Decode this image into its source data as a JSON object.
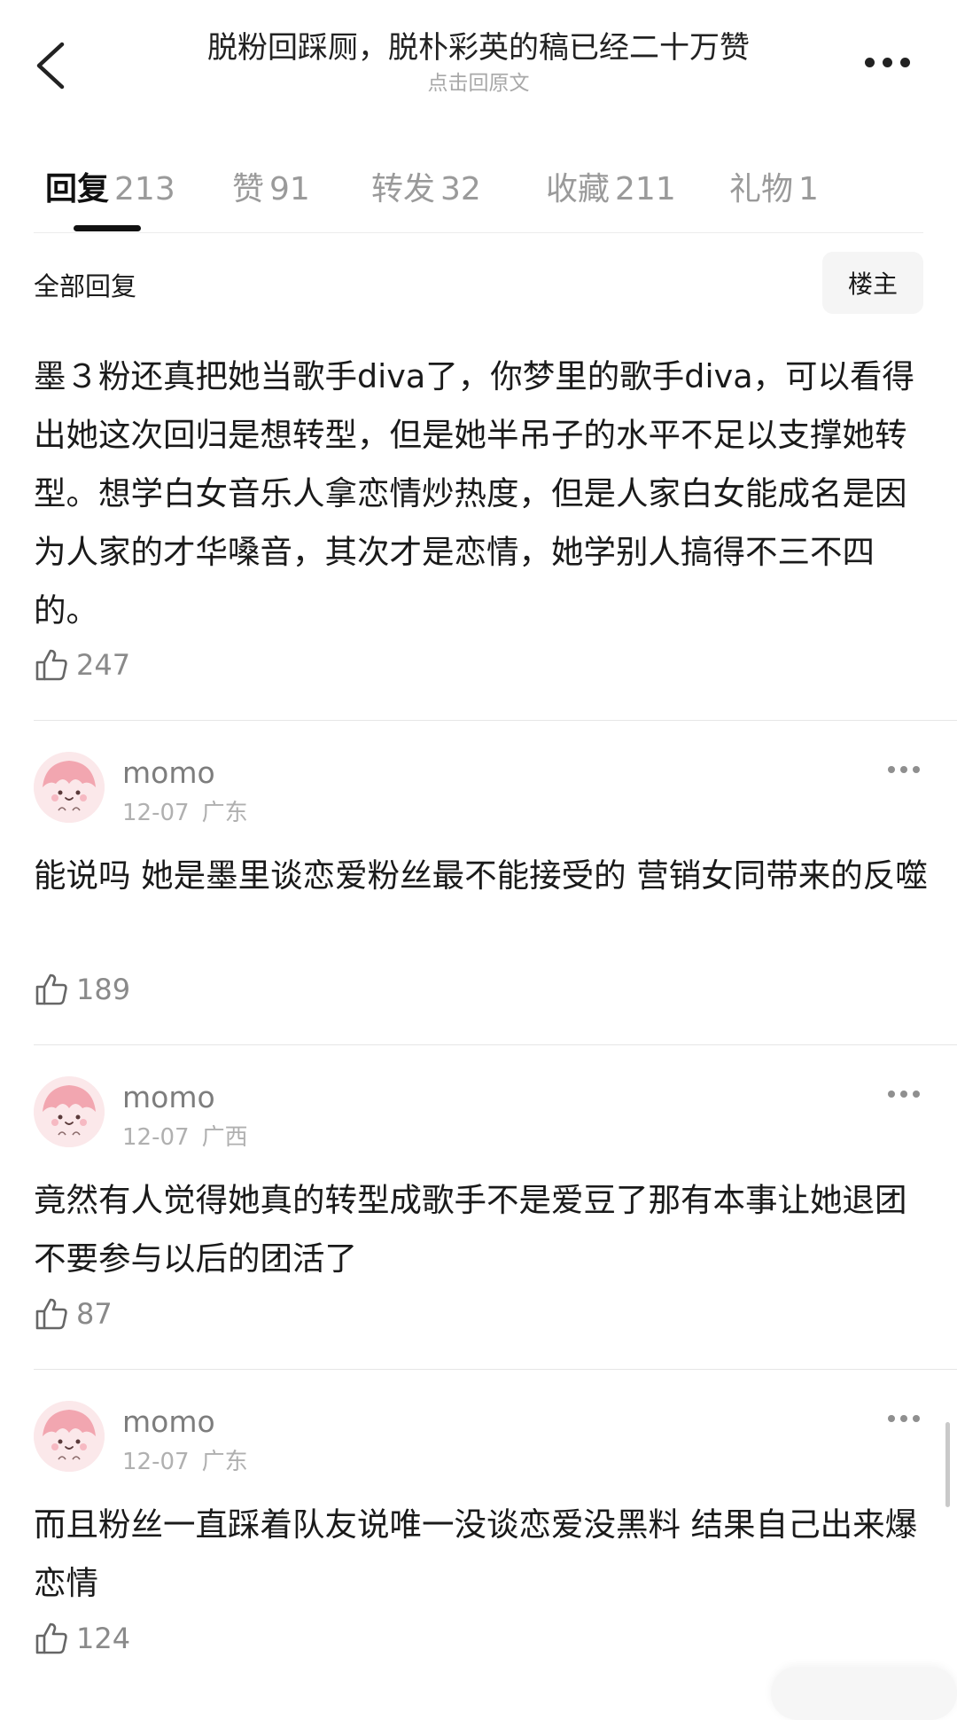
{
  "header": {
    "title": "脱粉回踩厕，脱朴彩英的稿已经二十万赞",
    "subtitle": "点击回原文",
    "back_icon": "chevron-left-icon",
    "more_icon": "more-horizontal-icon"
  },
  "tabs": [
    {
      "label": "回复",
      "count": "213",
      "active": true
    },
    {
      "label": "赞",
      "count": "91",
      "active": false
    },
    {
      "label": "转发",
      "count": "32",
      "active": false
    },
    {
      "label": "收藏",
      "count": "211",
      "active": false
    },
    {
      "label": "礼物",
      "count": "1",
      "active": false
    }
  ],
  "filter": {
    "label": "全部回复",
    "owner_button": "楼主"
  },
  "main_post": {
    "text": "墨３粉还真把她当歌手diva了，你梦里的歌手diva，可以看得出她这次回归是想转型，但是她半吊子的水平不足以支撑她转型。想学白女音乐人拿恋情炒热度，但是人家白女能成名是因为人家的才华嗓音，其次才是恋情，她学别人搞得不三不四的。",
    "likes": "247"
  },
  "comments": [
    {
      "username": "momo",
      "date": "12-07",
      "location": "广东",
      "text": "能说吗 她是墨里谈恋爱粉丝最不能接受的 营销女同带来的反噬",
      "likes": "189"
    },
    {
      "username": "momo",
      "date": "12-07",
      "location": "广西",
      "text": "竟然有人觉得她真的转型成歌手不是爱豆了那有本事让她退团不要参与以后的团活了",
      "likes": "87"
    },
    {
      "username": "momo",
      "date": "12-07",
      "location": "广东",
      "text": "而且粉丝一直踩着队友说唯一没谈恋爱没黑料 结果自己出来爆恋情",
      "likes": "124"
    }
  ],
  "colors": {
    "text_primary": "#1a1a1a",
    "text_secondary": "#8a8a8a",
    "tab_inactive": "#9a9a9a",
    "avatar_bg": "#fbe8ea"
  }
}
